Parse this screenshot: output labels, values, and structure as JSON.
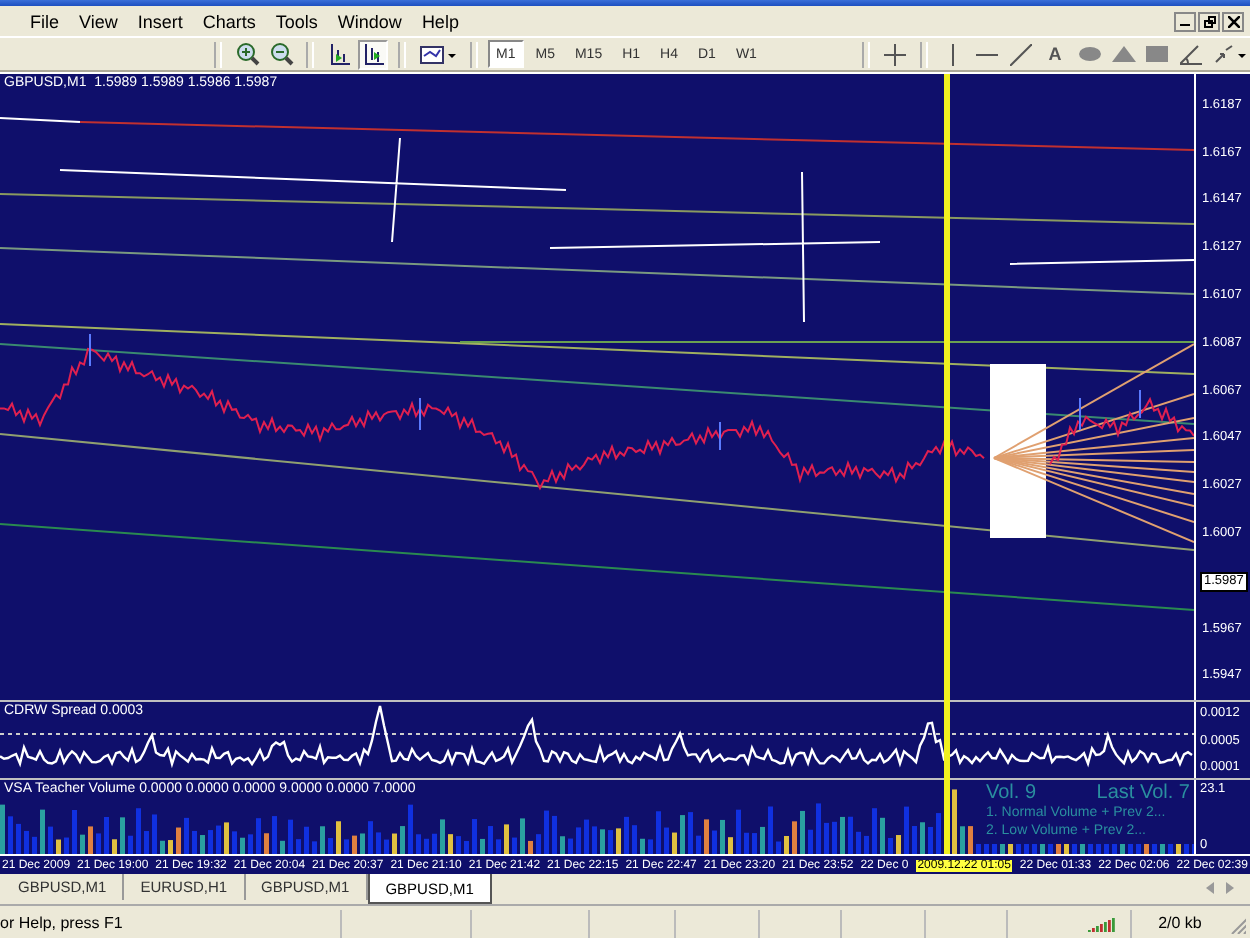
{
  "menu": [
    "File",
    "View",
    "Insert",
    "Charts",
    "Tools",
    "Window",
    "Help"
  ],
  "toolbar": {
    "timeframes": [
      {
        "label": "M1",
        "selected": true
      },
      {
        "label": "M5",
        "selected": false
      },
      {
        "label": "M15",
        "selected": false
      },
      {
        "label": "H1",
        "selected": false
      },
      {
        "label": "H4",
        "selected": false
      },
      {
        "label": "D1",
        "selected": false
      },
      {
        "label": "W1",
        "selected": false
      }
    ],
    "text_tool": "A"
  },
  "chart": {
    "title": "GBPUSD,M1  1.5989 1.5989 1.5986 1.5987",
    "price_axis": [
      {
        "label": "1.6187",
        "current": false
      },
      {
        "label": "1.6167",
        "current": false
      },
      {
        "label": "1.6147",
        "current": false
      },
      {
        "label": "1.6127",
        "current": false
      },
      {
        "label": "1.6107",
        "current": false
      },
      {
        "label": "1.6087",
        "current": false
      },
      {
        "label": "1.6067",
        "current": false
      },
      {
        "label": "1.6047",
        "current": false
      },
      {
        "label": "1.6027",
        "current": false
      },
      {
        "label": "1.6007",
        "current": false
      },
      {
        "label": "1.5987",
        "current": true
      },
      {
        "label": "1.5967",
        "current": false
      },
      {
        "label": "1.5947",
        "current": false
      }
    ],
    "spread": {
      "title": "CDRW Spread 0.0003",
      "axis": [
        "0.0012",
        "0.0005",
        "0.0001"
      ]
    },
    "volume": {
      "title": "VSA Teacher Volume 0.0000 0.0000 0.0000 9.0000 0.0000 7.0000",
      "axis": [
        "23.1",
        "0"
      ],
      "vol": "Vol. 9",
      "last_vol": "Last Vol. 7",
      "notes": [
        "1. Normal Volume + Prev 2...",
        "2. Low Volume + Prev 2..."
      ]
    },
    "time_axis": [
      {
        "label": "21 Dec 2009",
        "cursor": false
      },
      {
        "label": "21 Dec 19:00",
        "cursor": false
      },
      {
        "label": "21 Dec 19:32",
        "cursor": false
      },
      {
        "label": "21 Dec 20:04",
        "cursor": false
      },
      {
        "label": "21 Dec 20:37",
        "cursor": false
      },
      {
        "label": "21 Dec 21:10",
        "cursor": false
      },
      {
        "label": "21 Dec 21:42",
        "cursor": false
      },
      {
        "label": "21 Dec 22:15",
        "cursor": false
      },
      {
        "label": "21 Dec 22:47",
        "cursor": false
      },
      {
        "label": "21 Dec 23:20",
        "cursor": false
      },
      {
        "label": "21 Dec 23:52",
        "cursor": false
      },
      {
        "label": "22 Dec 0",
        "cursor": false
      },
      {
        "label": "2009.12.22 01:05",
        "cursor": true
      },
      {
        "label": "22 Dec 01:33",
        "cursor": false
      },
      {
        "label": "22 Dec 02:06",
        "cursor": false
      },
      {
        "label": "22 Dec 02:39",
        "cursor": false
      }
    ]
  },
  "tabs": [
    {
      "label": "GBPUSD,M1",
      "selected": false
    },
    {
      "label": "EURUSD,H1",
      "selected": false
    },
    {
      "label": "GBPUSD,M1",
      "selected": false
    },
    {
      "label": "GBPUSD,M1",
      "selected": true
    }
  ],
  "status_bar": {
    "help": "or Help, press F1",
    "traffic": "2/0 kb"
  }
}
